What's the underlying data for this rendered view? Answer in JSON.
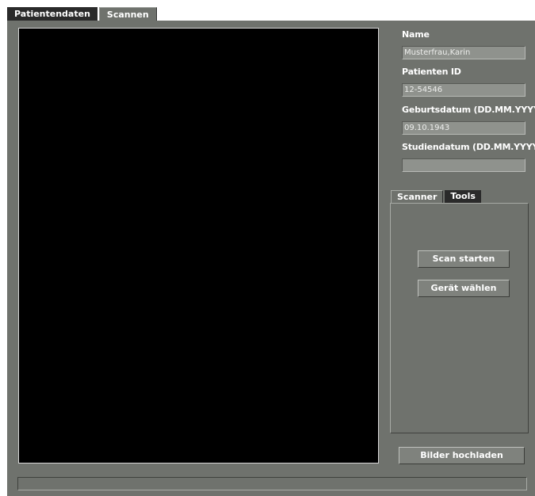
{
  "tabs": [
    {
      "label": "Patientendaten",
      "active": false
    },
    {
      "label": "Scannen",
      "active": true
    }
  ],
  "patient": {
    "name_label": "Name",
    "name_value": "Musterfrau,Karin",
    "id_label": "Patienten ID",
    "id_value": "12-54546",
    "birth_label": "Geburtsdatum (DD.MM.YYYY)",
    "birth_value": "09.10.1943",
    "study_label": "Studiendatum (DD.MM.YYYY)",
    "study_value": ""
  },
  "subtabs": [
    {
      "label": "Scanner",
      "active": true
    },
    {
      "label": "Tools",
      "active": false
    }
  ],
  "scanner": {
    "start_label": "Scan starten",
    "device_label": "Gerät wählen"
  },
  "upload_label": "Bilder hochladen",
  "status_text": "",
  "colors": {
    "panel": "#6f726d",
    "viewer": "#000000",
    "tab_inactive": "#2a2a2a",
    "input_bg": "#8f928d"
  }
}
